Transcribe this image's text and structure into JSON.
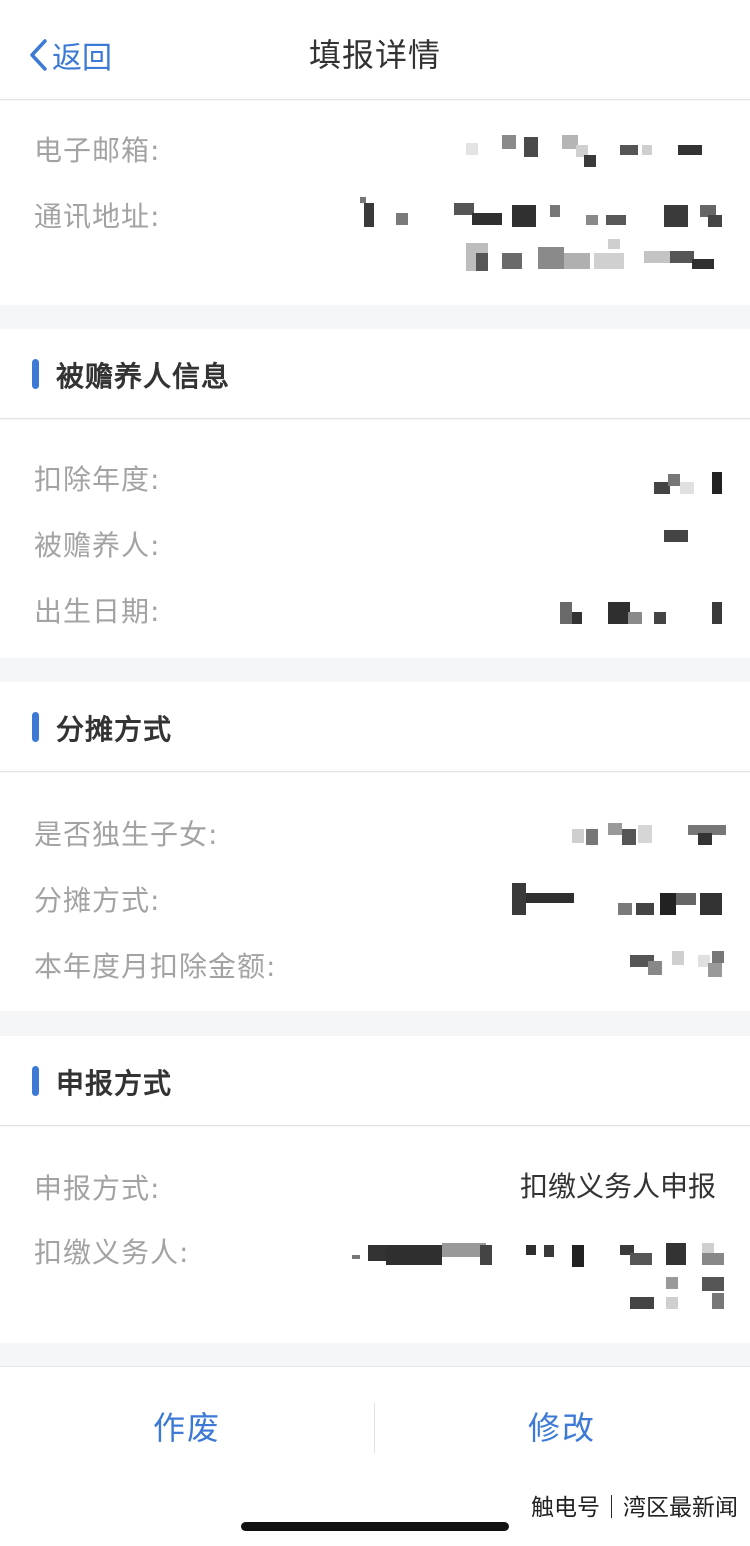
{
  "nav": {
    "back_label": "返回",
    "title": "填报详情"
  },
  "contact": {
    "email_label": "电子邮箱:",
    "address_label": "通讯地址:"
  },
  "dependent": {
    "section_title": "被赡养人信息",
    "year_label": "扣除年度:",
    "person_label": "被赡养人:",
    "birth_label": "出生日期:"
  },
  "allocation": {
    "section_title": "分摊方式",
    "only_child_label": "是否独生子女:",
    "method_label": "分摊方式:",
    "monthly_amount_label": "本年度月扣除金额:"
  },
  "filing": {
    "section_title": "申报方式",
    "method_label": "申报方式:",
    "method_value": "扣缴义务人申报",
    "withholder_label": "扣缴义务人:"
  },
  "footer": {
    "void_label": "作废",
    "edit_label": "修改"
  },
  "watermark": "触电号｜湾区最新闻",
  "colors": {
    "accent": "#3d7ad6",
    "label": "#a3a3a3",
    "text": "#333333",
    "background": "#f5f6f8"
  }
}
